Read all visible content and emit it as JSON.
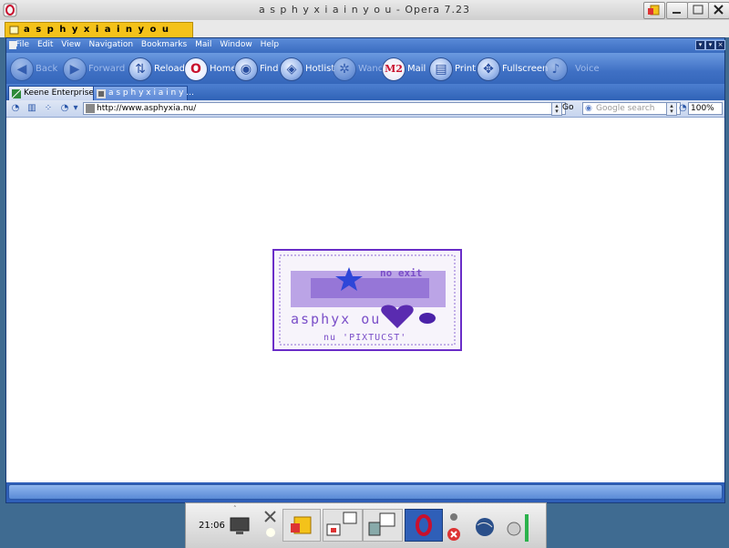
{
  "window": {
    "title": "a s p h y x i a i n y o u - Opera 7.23"
  },
  "doc_tab": {
    "title": "a s p h y x i a i n y o u"
  },
  "menu": {
    "items": [
      "File",
      "Edit",
      "View",
      "Navigation",
      "Bookmarks",
      "Mail",
      "Window",
      "Help"
    ]
  },
  "nav": {
    "back": "Back",
    "forward": "Forward",
    "reload": "Reload",
    "home": "Home",
    "find": "Find",
    "hotlist": "Hotlist",
    "wand": "Wand",
    "mail": "Mail",
    "mail_badge": "M2",
    "print": "Print",
    "fullscreen": "Fullscreen",
    "voice": "Voice"
  },
  "page_tabs": [
    {
      "label": "Keene Enterprises",
      "active": false
    },
    {
      "label": "a s p h y x i a i n y ...",
      "active": true
    }
  ],
  "address": {
    "url": "http://www.asphyxia.nu/",
    "go_label": "Go",
    "search_placeholder": "Google search",
    "zoom": "100%"
  },
  "logo": {
    "line1": "no exit",
    "line2": "asphyx   ou",
    "line3": "nu 'PIXTUCST'"
  },
  "taskbar": {
    "clock": "21:06"
  },
  "colors": {
    "desktop": "#3f6b91",
    "browser_chrome": "#3a6cc0",
    "doc_tab": "#f4c21a",
    "logo_border": "#6a2ec8"
  }
}
